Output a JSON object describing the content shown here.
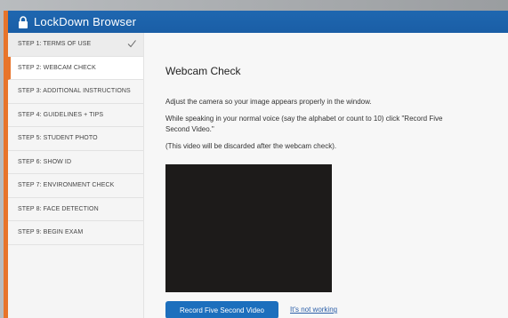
{
  "app": {
    "title": "LockDown Browser"
  },
  "sidebar": {
    "steps": [
      {
        "label": "STEP 1: TERMS OF USE",
        "state": "done"
      },
      {
        "label": "STEP 2: WEBCAM CHECK",
        "state": "active"
      },
      {
        "label": "STEP 3: ADDITIONAL INSTRUCTIONS",
        "state": "pending"
      },
      {
        "label": "STEP 4: GUIDELINES + TIPS",
        "state": "pending"
      },
      {
        "label": "STEP 5: STUDENT PHOTO",
        "state": "pending"
      },
      {
        "label": "STEP 6: SHOW ID",
        "state": "pending"
      },
      {
        "label": "STEP 7: ENVIRONMENT CHECK",
        "state": "pending"
      },
      {
        "label": "STEP 8: FACE DETECTION",
        "state": "pending"
      },
      {
        "label": "STEP 9: BEGIN EXAM",
        "state": "pending"
      }
    ]
  },
  "main": {
    "heading": "Webcam Check",
    "instructions": [
      "Adjust the camera so your image appears properly in the window.",
      "While speaking in your normal voice (say the alphabet or count to 10) click \"Record Five Second Video.\"",
      "(This video will be discarded after the webcam check)."
    ],
    "record_button": "Record Five Second Video",
    "not_working_link": "It's not working"
  },
  "colors": {
    "titlebar": "#1a5ea6",
    "accent": "#e8742a",
    "button": "#1c6fbd"
  },
  "icons": {
    "title": "lock-icon",
    "step_done": "checkmark-icon"
  }
}
